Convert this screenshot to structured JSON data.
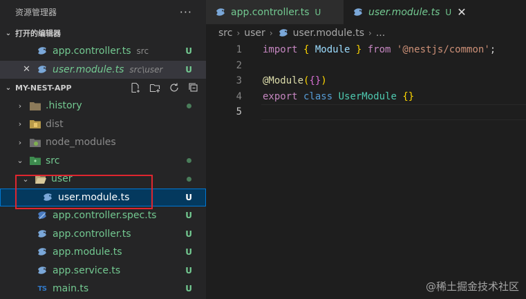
{
  "sidebar": {
    "title": "资源管理器",
    "more": "···",
    "open_editors": {
      "header": "打开的编辑器",
      "items": [
        {
          "label": "app.controller.ts",
          "hint": "src",
          "badge": "U"
        },
        {
          "label": "user.module.ts",
          "hint": "src\\user",
          "badge": "U",
          "close": "✕"
        }
      ]
    },
    "project": {
      "header": "MY-NEST-APP",
      "tree": [
        {
          "label": ".history",
          "chevron": "›"
        },
        {
          "label": "dist",
          "chevron": "›"
        },
        {
          "label": "node_modules",
          "chevron": "›"
        },
        {
          "label": "src",
          "chevron": "⌄"
        },
        {
          "label": "user",
          "chevron": "⌄"
        },
        {
          "label": "user.module.ts",
          "badge": "U"
        },
        {
          "label": "app.controller.spec.ts",
          "badge": "U"
        },
        {
          "label": "app.controller.ts",
          "badge": "U"
        },
        {
          "label": "app.module.ts",
          "badge": "U"
        },
        {
          "label": "app.service.ts",
          "badge": "U"
        },
        {
          "label": "main.ts",
          "badge": "U"
        }
      ]
    },
    "ts_icon_text": "TS"
  },
  "editor": {
    "tabs": [
      {
        "label": "app.controller.ts",
        "badge": "U"
      },
      {
        "label": "user.module.ts",
        "badge": "U",
        "close": "✕"
      }
    ],
    "breadcrumb": {
      "seg1": "src",
      "seg2": "user",
      "seg3": "user.module.ts",
      "seg4": "..."
    },
    "lines": [
      {
        "n": "1"
      },
      {
        "n": "2"
      },
      {
        "n": "3"
      },
      {
        "n": "4"
      },
      {
        "n": "5"
      }
    ],
    "code": {
      "l1_import": "import",
      "l1_open": "{ ",
      "l1_module": "Module",
      "l1_close": " }",
      "l1_from": " from ",
      "l1_str": "'@nestjs/common'",
      "l1_semi": ";",
      "l3_at": "@Module",
      "l3_p1": "(",
      "l3_braces": "{}",
      "l3_p2": ")",
      "l4_export": "export",
      "l4_class": " class ",
      "l4_name": "UserModule",
      "l4_braces": " {}"
    }
  },
  "watermark": "@稀土掘金技术社区",
  "colors": {
    "accent": "#0078d4",
    "git_untracked": "#73c991",
    "highlight_box": "#e0262f"
  }
}
